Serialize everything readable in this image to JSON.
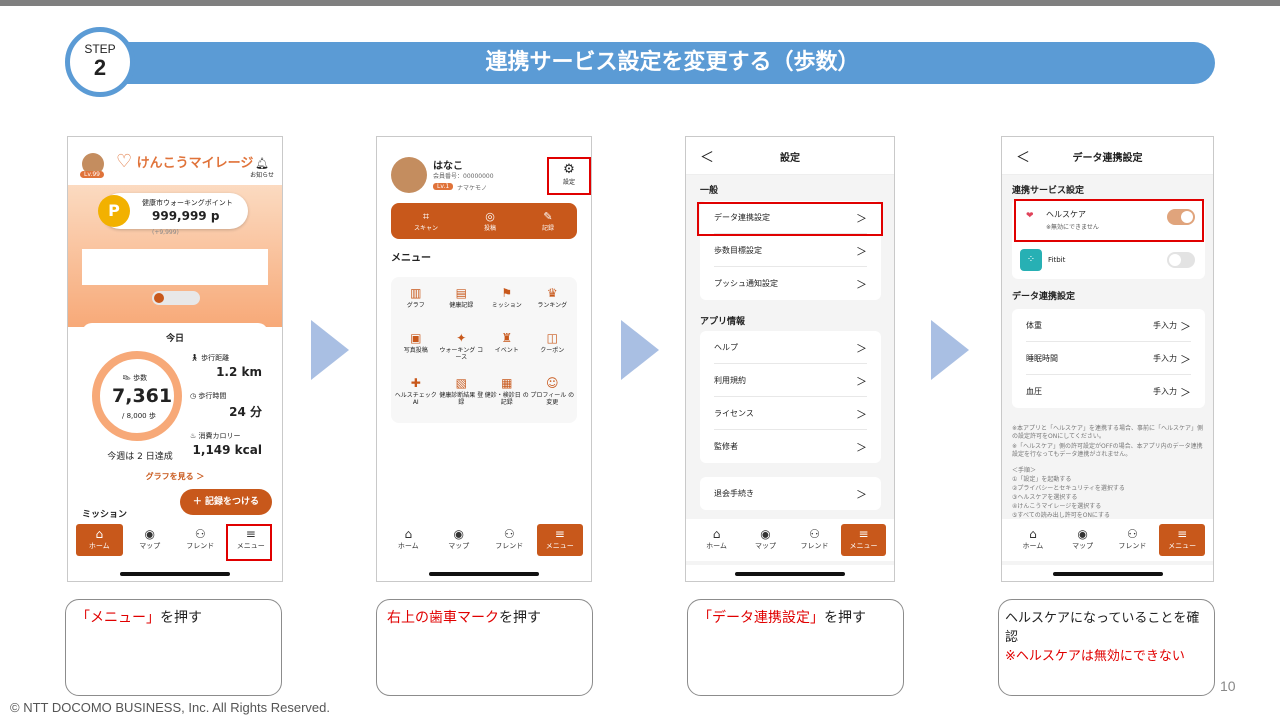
{
  "header": {
    "step_label": "STEP",
    "step_number": "2",
    "title": "連携サービス設定を変更する（歩数）",
    "banner_color": "#5b9bd5"
  },
  "phone1": {
    "app_name": "けんこうマイレージ",
    "level": "Lv.99",
    "notify": "お知らせ",
    "point_label": "健康市ウォーキングポイント",
    "point_value": "999,999 p",
    "point_delta": "(+9,999)",
    "today": "今日",
    "steps_label": "歩数",
    "steps_value": "7,361",
    "steps_goal": "/ 8,000 歩",
    "distance_label": "歩行距離",
    "distance_value": "1.2 km",
    "time_label": "歩行時間",
    "time_value": "24 分",
    "cal_label": "消費カロリー",
    "cal_value": "1,149 kcal",
    "week": "今週は 2 日達成",
    "graph_link": "グラフを見る ＞",
    "record_button": "＋ 記録をつける",
    "mission": "ミッション",
    "accent_color": "#c8581b"
  },
  "phone2": {
    "name": "はなこ",
    "member_no": "会員番号：00000000",
    "level": "Lv.1",
    "nickname": "ナマケモノ",
    "settings": "設定",
    "quick": [
      {
        "icon": "⌗",
        "label": "スキャン"
      },
      {
        "icon": "◎",
        "label": "投稿"
      },
      {
        "icon": "✎",
        "label": "記録"
      }
    ],
    "menu_title": "メニュー",
    "menu": [
      {
        "icon": "▥",
        "label": "グラフ"
      },
      {
        "icon": "▤",
        "label": "健康記録"
      },
      {
        "icon": "⚑",
        "label": "ミッション"
      },
      {
        "icon": "♛",
        "label": "ランキング"
      },
      {
        "icon": "▣",
        "label": "写真投稿"
      },
      {
        "icon": "✦",
        "label": "ウォーキング コース"
      },
      {
        "icon": "♜",
        "label": "イベント"
      },
      {
        "icon": "◫",
        "label": "クーポン"
      },
      {
        "icon": "✚",
        "label": "ヘルスチェックAI"
      },
      {
        "icon": "▧",
        "label": "健康診断結果 登録"
      },
      {
        "icon": "▦",
        "label": "健診・検診日 の記録"
      },
      {
        "icon": "☺",
        "label": "プロフィール の変更"
      }
    ]
  },
  "phone3": {
    "title": "設定",
    "back": "＜",
    "section1": "一般",
    "general": [
      "データ連携設定",
      "歩数目標設定",
      "プッシュ通知設定"
    ],
    "section2": "アプリ情報",
    "appinfo": [
      "ヘルプ",
      "利用規約",
      "ライセンス",
      "監修者"
    ],
    "leave": "退会手続き",
    "chevron": "＞"
  },
  "phone4": {
    "title": "データ連携設定",
    "back": "＜",
    "section1": "連携サービス設定",
    "healthcare": "ヘルスケア",
    "healthcare_note": "※無効にできません",
    "fitbit": "Fitbit",
    "section2": "データ連携設定",
    "data_rows": [
      {
        "label": "体重",
        "value": "手入力"
      },
      {
        "label": "睡眠時間",
        "value": "手入力"
      },
      {
        "label": "血圧",
        "value": "手入力"
      }
    ],
    "note1": "※本アプリと「ヘルスケア」を連携する場合、事前に「ヘルスケア」側の設定許可をONにしてください。",
    "note2": "※「ヘルスケア」側の許可設定がOFFの場合、本アプリ内のデータ連携設定を行なってもデータ連携がされません。",
    "steps_title": "＜手順＞",
    "steps": [
      "①「設定」を起動する",
      "②プライバシーとセキュリティを選択する",
      "③ヘルスケアを選択する",
      "④けんこうマイレージを選択する",
      "⑤すべての読み出し許可をONにする"
    ],
    "chevron": "＞",
    "toggle_on_color": "#e0a47c",
    "toggle_off_color": "#e3e3e3"
  },
  "tabbar": [
    {
      "icon": "⌂",
      "label": "ホーム"
    },
    {
      "icon": "◉",
      "label": "マップ"
    },
    {
      "icon": "⚇",
      "label": "フレンド"
    },
    {
      "icon": "≡",
      "label": "メニュー"
    }
  ],
  "captions": {
    "c1_red": "「メニュー」",
    "c1_rest": "を押す",
    "c2_red": "右上の歯車マーク",
    "c2_rest": "を押す",
    "c3_red": "「データ連携設定」",
    "c3_rest": "を押す",
    "c4_line1": "ヘルスケアになっていることを確認",
    "c4_line2": "※ヘルスケアは無効にできない"
  },
  "footer": {
    "copyright": "© NTT DOCOMO BUSINESS, Inc. All Rights Reserved.",
    "page_number": "10"
  }
}
